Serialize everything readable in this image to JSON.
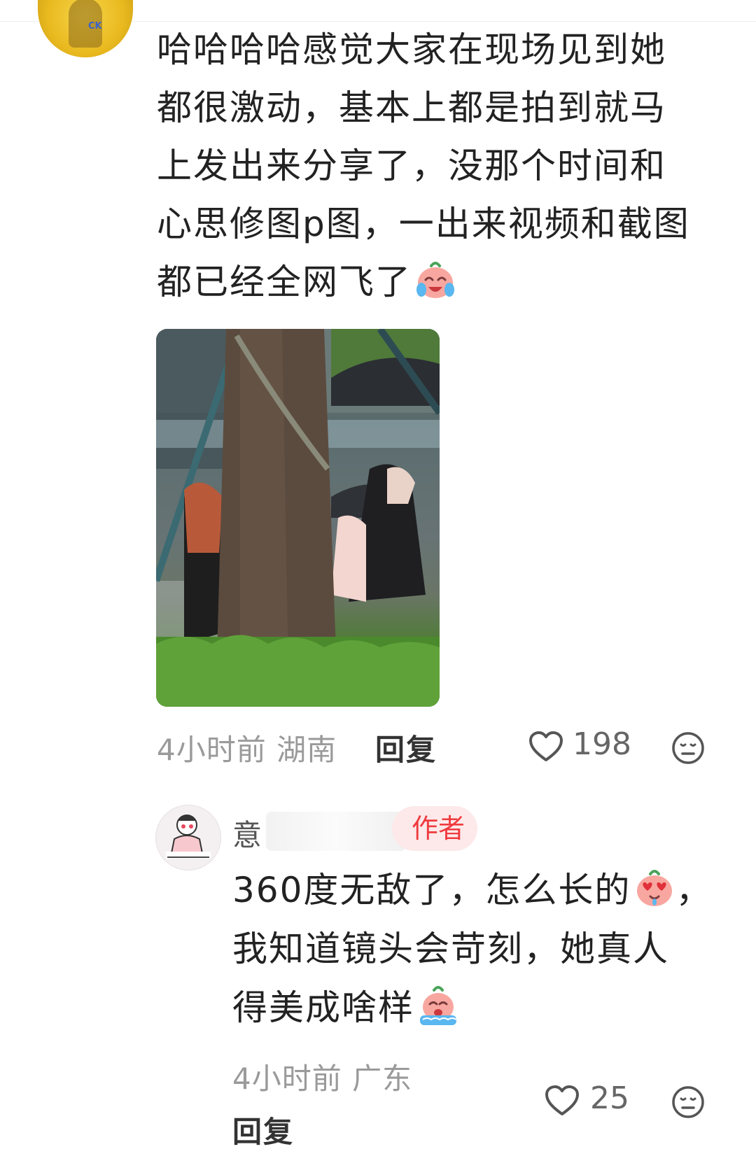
{
  "comment1": {
    "avatar_text": "CK",
    "lines": [
      "哈哈哈哈感觉大家在现场见到她",
      "都很激动，基本上都是拍到就马",
      "上发出来分享了，没那个时间和",
      "心思修图p图，一出来视频和截图",
      "都已经全网飞了"
    ],
    "emoji": "crying-laughing-emoji",
    "time": "4小时前",
    "location": "湖南",
    "reply_label": "回复",
    "like_count": "198"
  },
  "comment2": {
    "username_visible": "意",
    "badge_label": "作者",
    "line1": "360度无敌了，怎么长的",
    "line1_end": "，",
    "line2": "我知道镜头会苛刻，她真人",
    "line3": "得美成啥样",
    "time": "4小时前",
    "location": "广东",
    "reply_label": "回复",
    "like_count": "25"
  },
  "colors": {
    "badge_bg": "#fde9ea",
    "badge_text": "#ef3b3f",
    "meta_gray": "#9a9a9a"
  }
}
